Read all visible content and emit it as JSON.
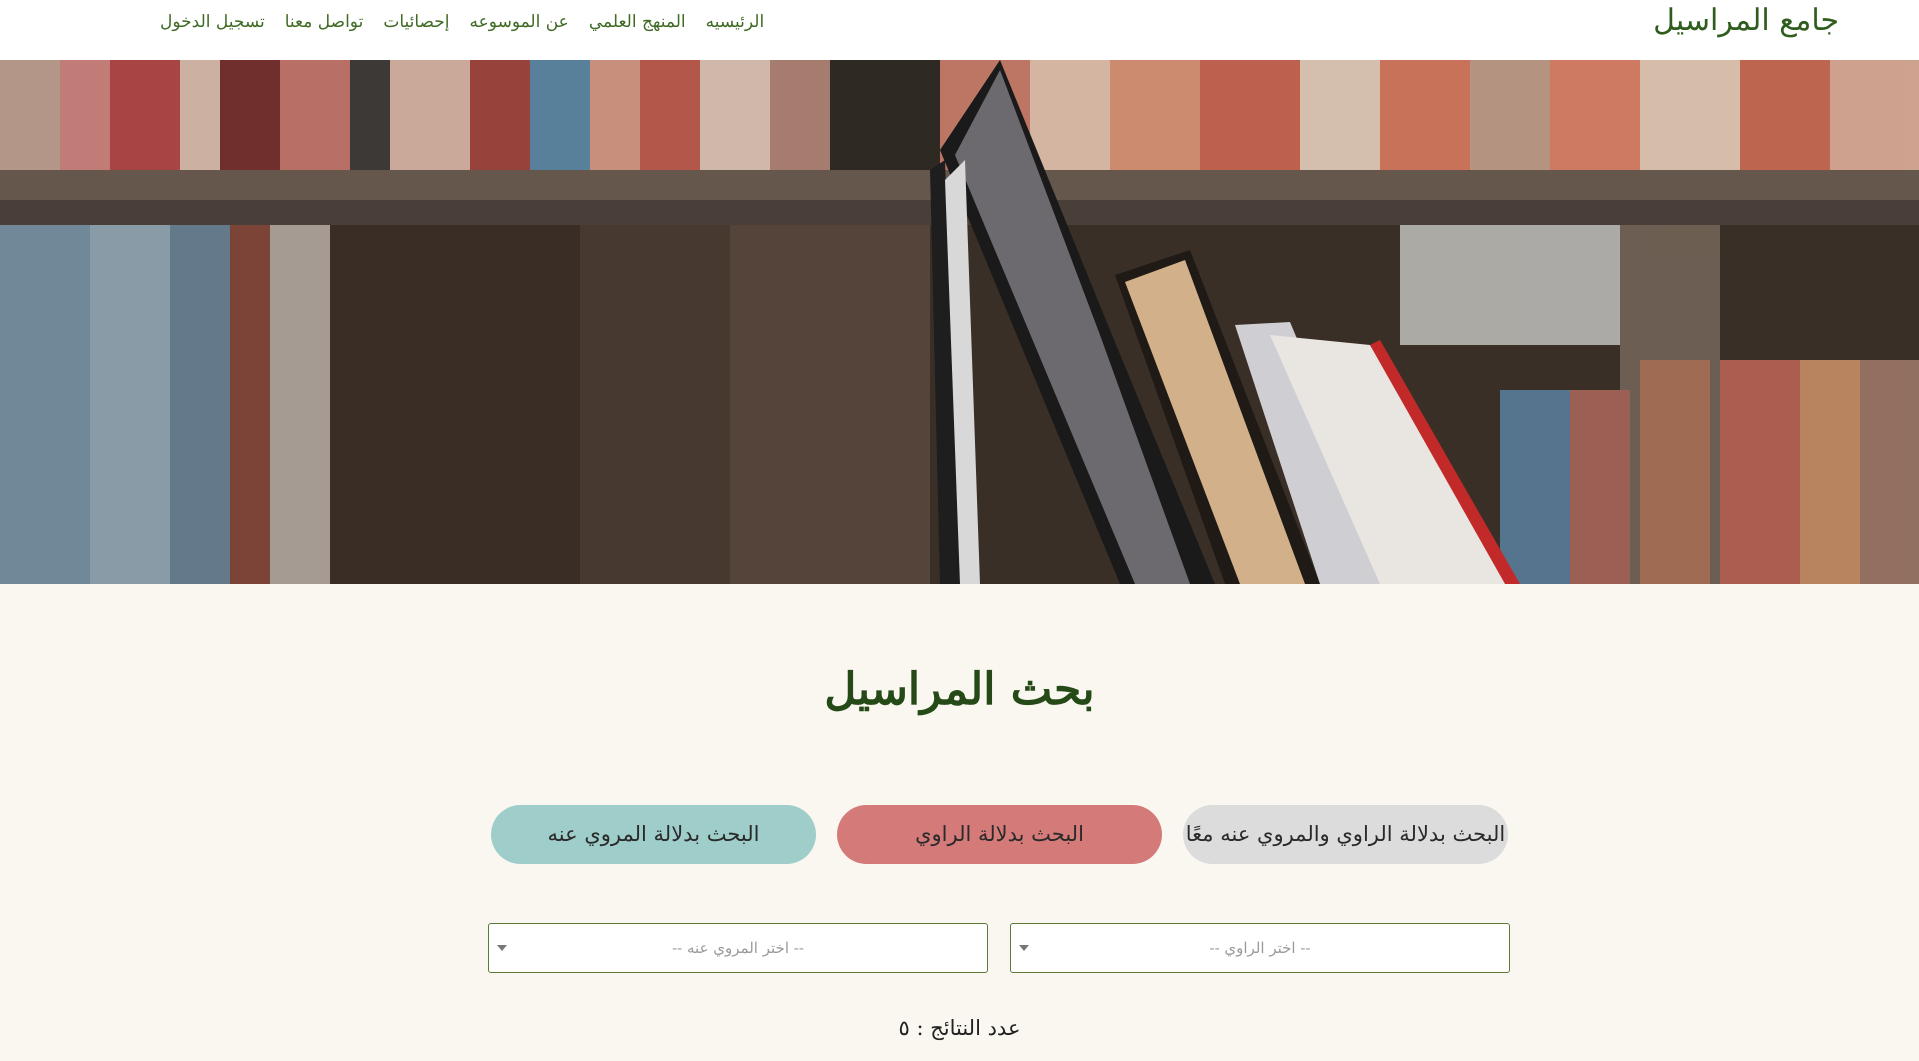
{
  "header": {
    "brand": "جامع المراسيل",
    "nav": [
      {
        "label": "الرئيسيه"
      },
      {
        "label": "المنهج العلمي"
      },
      {
        "label": "عن الموسوعه"
      },
      {
        "label": "إحصائيات"
      },
      {
        "label": "تواصل معنا"
      },
      {
        "label": "تسجيل الدخول"
      }
    ]
  },
  "main": {
    "title": "بحث المراسيل",
    "search_modes": [
      {
        "label": "البحث بدلالة الراوي والمروي عنه معًا",
        "color": "#dcdcdc"
      },
      {
        "label": "البحث بدلالة الراوي",
        "color": "#d47b7a"
      },
      {
        "label": "البحث بدلالة المروي عنه",
        "color": "#9fcdca"
      }
    ],
    "selects": {
      "narrator": {
        "selected": "-- اختر الراوي --"
      },
      "narrated": {
        "selected": "-- اختر المروي عنه --"
      }
    },
    "results_label": "عدد النتائج :",
    "results_count": "٥"
  },
  "colors": {
    "brand_green": "#2f5d1e",
    "title_green": "#264a17",
    "page_background": "#f9f7f0"
  }
}
